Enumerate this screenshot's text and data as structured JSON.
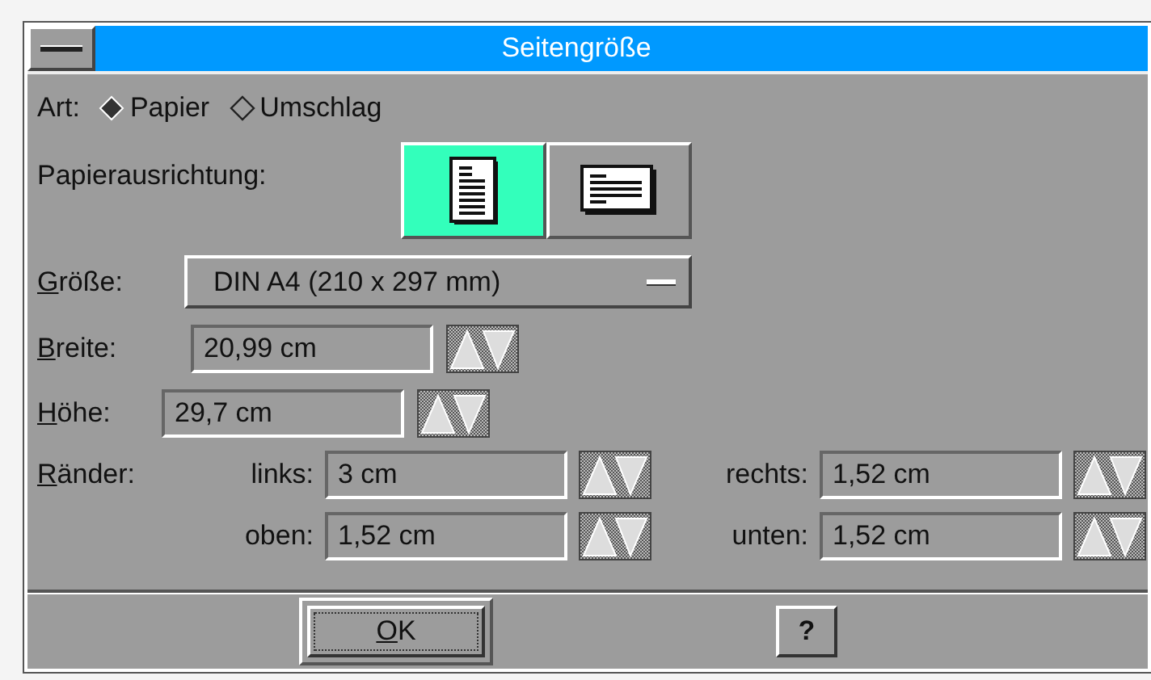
{
  "window": {
    "title": "Seitengröße"
  },
  "type": {
    "label": "Art:",
    "options": [
      {
        "label": "Papier",
        "selected": true
      },
      {
        "label": "Umschlag",
        "selected": false
      }
    ]
  },
  "orientation": {
    "label": "Papierausrichtung:",
    "options": [
      {
        "kind": "portrait",
        "selected": true
      },
      {
        "kind": "landscape",
        "selected": false
      }
    ]
  },
  "size": {
    "label": "Größe:",
    "mnemonic": true,
    "value": "DIN A4 (210 x 297 mm)"
  },
  "width": {
    "label": "Breite:",
    "mnemonic": true,
    "value": "20,99 cm"
  },
  "height": {
    "label": "Höhe:",
    "mnemonic": true,
    "value": "29,7 cm"
  },
  "margins": {
    "label": "Ränder:",
    "mnemonic": true,
    "fields": [
      {
        "label": "links:",
        "value": "3 cm"
      },
      {
        "label": "rechts:",
        "value": "1,52 cm"
      },
      {
        "label": "oben:",
        "value": "1,52 cm"
      },
      {
        "label": "unten:",
        "value": "1,52 cm"
      }
    ]
  },
  "buttons": [
    {
      "kind": "ok",
      "label": "OK",
      "mnemonic": true,
      "default": true
    },
    {
      "kind": "help",
      "label": "?"
    }
  ]
}
